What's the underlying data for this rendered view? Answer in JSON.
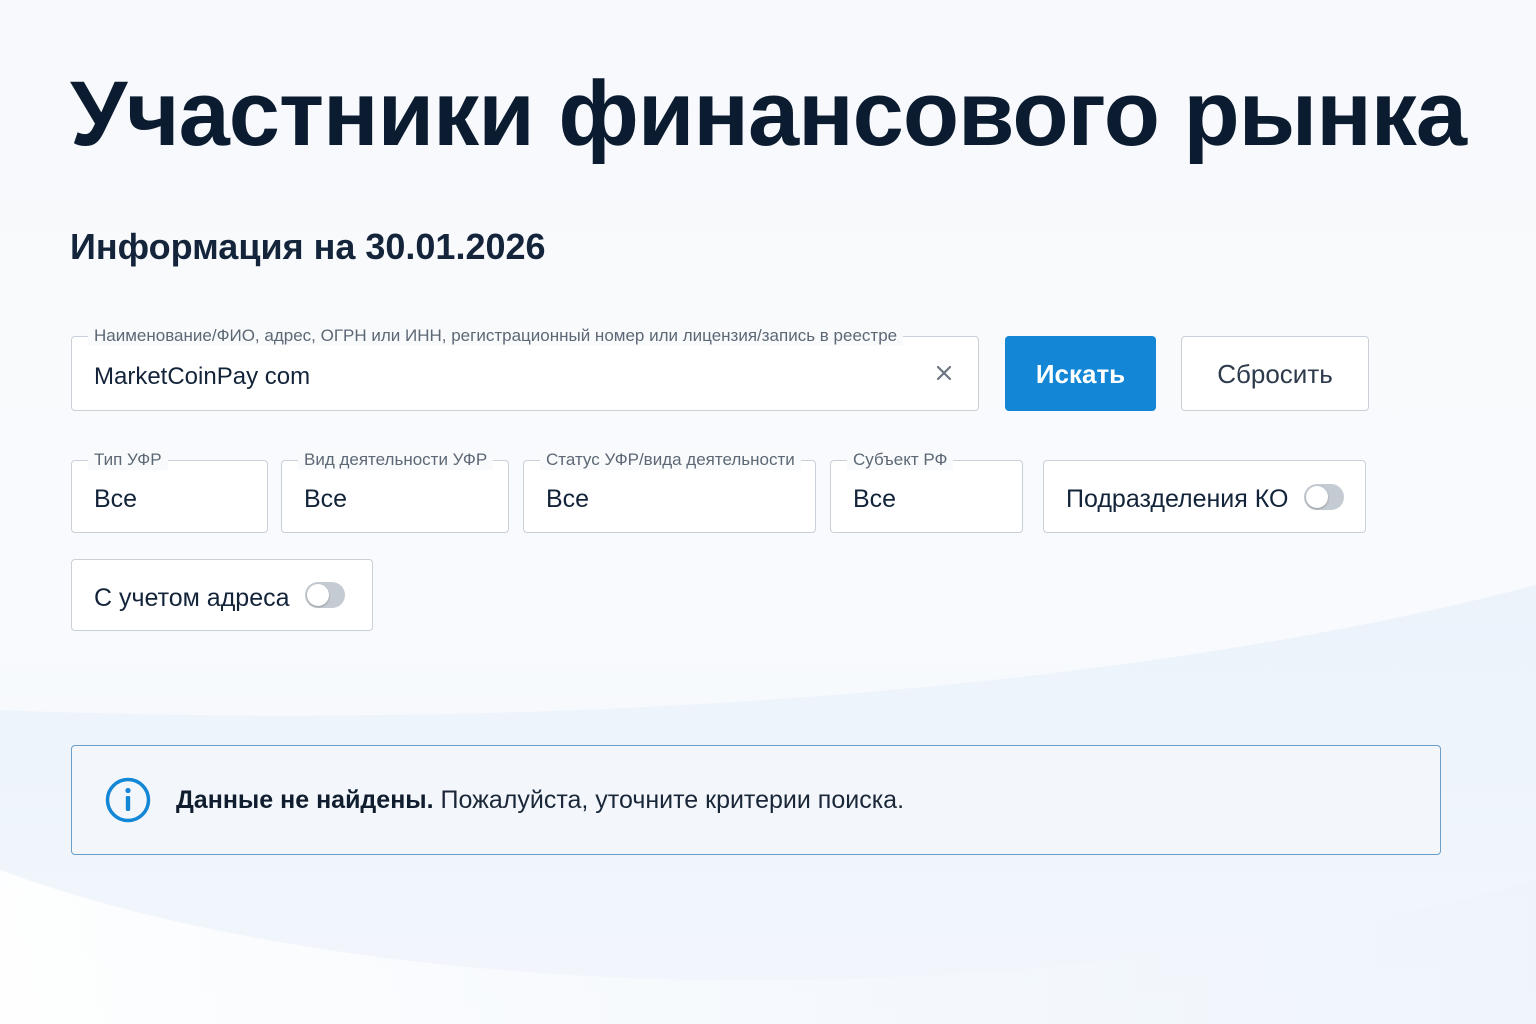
{
  "page": {
    "title": "Участники финансового рынка",
    "subtitle": "Информация на 30.01.2026"
  },
  "search": {
    "label": "Наименование/ФИО, адрес, ОГРН или ИНН, регистрационный номер или лицензия/запись в реестре",
    "value": "MarketCoinPay com",
    "clear_icon": "close-icon",
    "search_button": "Искать",
    "reset_button": "Сбросить"
  },
  "filters": [
    {
      "label": "Тип УФР",
      "value": "Все"
    },
    {
      "label": "Вид деятельности УФР",
      "value": "Все"
    },
    {
      "label": "Статус УФР/вида деятельности",
      "value": "Все"
    },
    {
      "label": "Субъект РФ",
      "value": "Все"
    }
  ],
  "toggles": [
    {
      "label": "Подразделения КО",
      "on": false
    },
    {
      "label": "С учетом адреса",
      "on": false
    }
  ],
  "alert": {
    "icon": "info-icon",
    "bold": "Данные не найдены.",
    "text": " Пожалуйста, уточните критерии поиска."
  },
  "colors": {
    "accent": "#1386d6",
    "title": "#0c1c30",
    "alert_border": "#6a9ec8",
    "toggle_off": "#c5cbd2"
  }
}
